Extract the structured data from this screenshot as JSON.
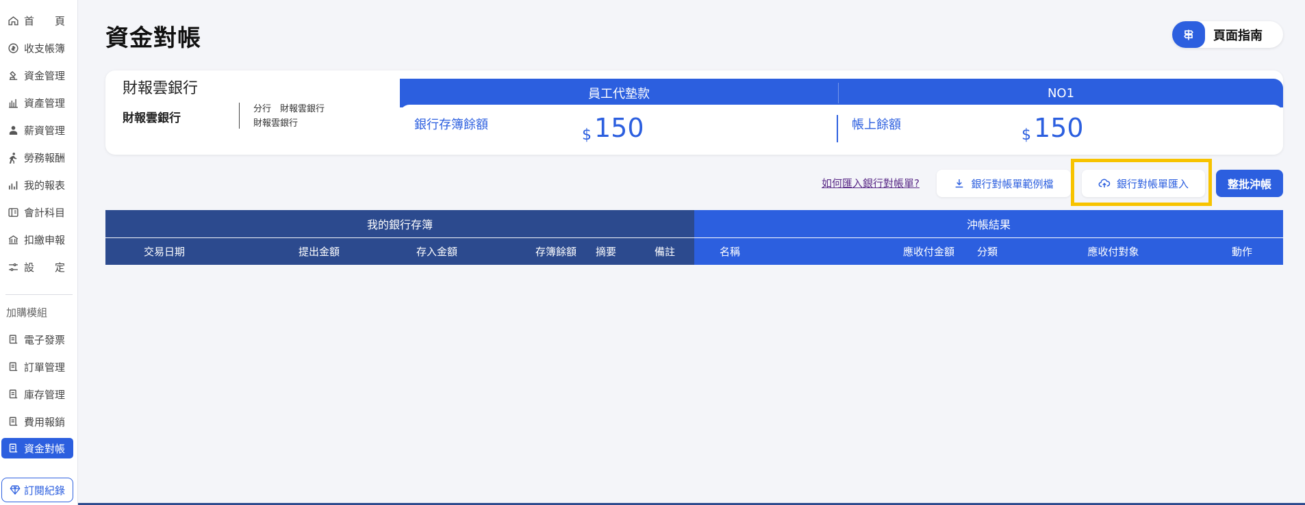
{
  "sidebar": {
    "items": [
      {
        "label": "首　　頁",
        "icon": "home-icon"
      },
      {
        "label": "收支帳簿",
        "icon": "coin-icon"
      },
      {
        "label": "資金管理",
        "icon": "fund-icon"
      },
      {
        "label": "資產管理",
        "icon": "assets-icon"
      },
      {
        "label": "薪資管理",
        "icon": "payroll-icon"
      },
      {
        "label": "勞務報酬",
        "icon": "service-icon"
      },
      {
        "label": "我的報表",
        "icon": "report-icon"
      },
      {
        "label": "會計科目",
        "icon": "accounts-icon"
      },
      {
        "label": "扣繳申報",
        "icon": "tax-icon"
      },
      {
        "label": "設　　定",
        "icon": "settings-icon"
      }
    ],
    "addon_section_label": "加購模組",
    "addon_items": [
      {
        "label": "電子發票",
        "icon": "module-icon",
        "active": false
      },
      {
        "label": "訂單管理",
        "icon": "module-icon",
        "active": false
      },
      {
        "label": "庫存管理",
        "icon": "module-icon",
        "active": false
      },
      {
        "label": "費用報銷",
        "icon": "module-icon",
        "active": false
      },
      {
        "label": "資金對帳",
        "icon": "module-icon",
        "active": true
      }
    ],
    "subscription_label": "訂閱紀錄"
  },
  "header": {
    "title": "資金對帳",
    "guide_label": "頁面指南"
  },
  "account": {
    "bank_name": "財報雲銀行",
    "bank_sub": "財報雲銀行",
    "branch_line1": "分行　財報雲銀行",
    "branch_line2": "財報雲銀行",
    "tabs": [
      "員工代墊款",
      "NO1"
    ],
    "book_balance_label": "銀行存簿餘額",
    "book_balance_currency": "$",
    "book_balance_value": "150",
    "ledger_balance_label": "帳上餘額",
    "ledger_balance_currency": "$",
    "ledger_balance_value": "150"
  },
  "actions": {
    "help_link": "如何匯入銀行對帳單?",
    "sample_button": "銀行對帳單範例檔",
    "import_button": "銀行對帳單匯入",
    "batch_button": "整批沖帳"
  },
  "table": {
    "group_left": "我的銀行存簿",
    "group_right": "沖帳結果",
    "columns_left": [
      "交易日期",
      "提出金額",
      "存入金額",
      "存簿餘額",
      "摘要",
      "備註"
    ],
    "columns_right": [
      "名稱",
      "應收付金額",
      "分類",
      "應收付對象",
      "動作"
    ]
  },
  "colors": {
    "primary": "#2c5fdf",
    "navy": "#2c4a8e",
    "highlight": "#f7c300",
    "background": "#f4f5f9"
  }
}
